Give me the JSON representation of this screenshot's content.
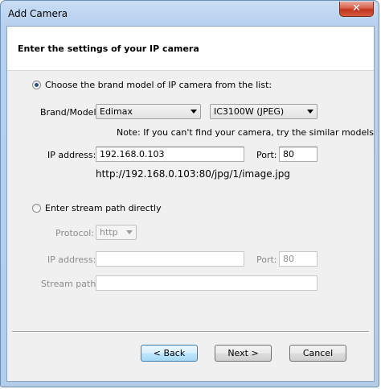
{
  "window": {
    "title": "Add Camera",
    "close_glyph": "✕"
  },
  "header": {
    "title": "Enter the settings of your IP camera"
  },
  "brand_mode": {
    "radio_label": "Choose the brand model of  IP camera from the list:",
    "selected": true,
    "brand_label": "Brand/Model:",
    "brand_value": "Edimax",
    "model_value": "IC3100W (JPEG)",
    "note": "Note: If you can't find your camera, try the similar models",
    "ip_label": "IP address:",
    "ip_value": "192.168.0.103",
    "port_label": "Port:",
    "port_value": "80",
    "url": "http://192.168.0.103:80/jpg/1/image.jpg"
  },
  "stream_mode": {
    "radio_label": "Enter stream path directly",
    "selected": false,
    "protocol_label": "Protocol:",
    "protocol_value": "http",
    "ip_label": "IP address:",
    "ip_value": "",
    "port_label": "Port:",
    "port_value": "80",
    "stream_label": "Stream path:",
    "stream_value": ""
  },
  "buttons": {
    "back": "< Back",
    "next": "Next >",
    "cancel": "Cancel"
  }
}
